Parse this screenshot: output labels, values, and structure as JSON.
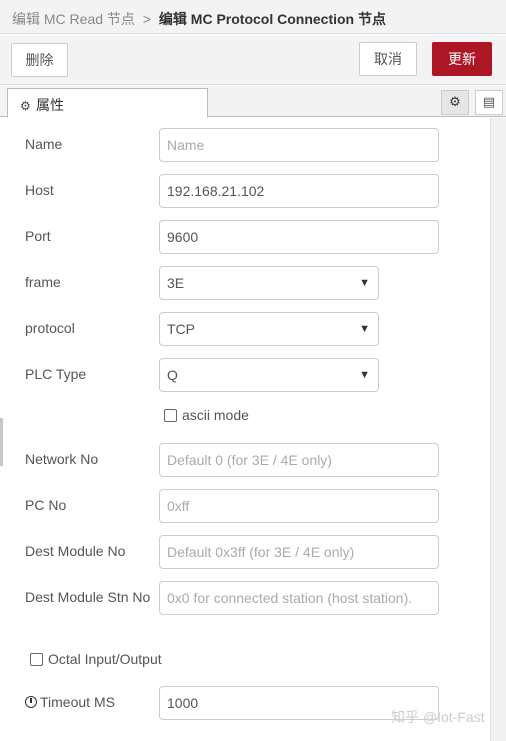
{
  "breadcrumb": {
    "parent": "编辑 MC Read 节点",
    "separator": ">",
    "current": "编辑 MC Protocol Connection 节点"
  },
  "toolbar": {
    "delete_label": "删除",
    "cancel_label": "取消",
    "update_label": "更新"
  },
  "tabs": {
    "properties_label": "属性"
  },
  "form": {
    "name": {
      "label": "Name",
      "value": "",
      "placeholder": "Name"
    },
    "host": {
      "label": "Host",
      "value": "192.168.21.102"
    },
    "port": {
      "label": "Port",
      "value": "9600"
    },
    "frame": {
      "label": "frame",
      "value": "3E"
    },
    "protocol": {
      "label": "protocol",
      "value": "TCP"
    },
    "plc_type": {
      "label": "PLC Type",
      "value": "Q"
    },
    "ascii_mode": {
      "label": "ascii mode",
      "checked": false
    },
    "network_no": {
      "label": "Network No",
      "placeholder": "Default 0 (for 3E / 4E only)"
    },
    "pc_no": {
      "label": "PC No",
      "placeholder": "0xff"
    },
    "dest_module_no": {
      "label": "Dest Module No",
      "placeholder": "Default 0x3ff (for 3E / 4E only)"
    },
    "dest_module_stn_no": {
      "label": "Dest Module Stn No",
      "placeholder": "0x0 for connected station (host station)."
    },
    "octal_io": {
      "label": "Octal Input/Output",
      "checked": false
    },
    "timeout_ms": {
      "label": "Timeout MS",
      "value": "1000"
    }
  },
  "watermark": "知乎 @Iot-Fast",
  "colors": {
    "accent": "#ad1625",
    "header_bg": "#f3f3f3",
    "border": "#cccccc"
  }
}
